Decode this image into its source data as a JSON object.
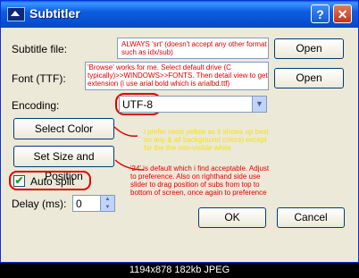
{
  "window": {
    "title": "Subtitler",
    "help_button": "?",
    "close_button": "✕"
  },
  "labels": {
    "subtitle_file": "Subtitle file:",
    "font": "Font (TTF):",
    "encoding": "Encoding:",
    "delay": "Delay (ms):"
  },
  "notes": {
    "subtitle_note": "ALWAYS 'srt' (doesn't accept any other format such as idx/sub)",
    "font_note": "'Browse' works for me.  Select default drive (C typically)>>WINDOWS>>FONTS.  Then detail view to get extension (i use arial bold which is arialbd.ttf)",
    "color_note": "i prefer neon yellow as it shows up best on any & all background colors) except for the the non-visible white",
    "size_note": "'24' is default which i find acceptable. Adjust to preference.  Also on righthand side use slider to drag position of subs from top to bottom of screen, once again to preference"
  },
  "inputs": {
    "subtitle_file_value": "",
    "font_value": "",
    "encoding_value": "UTF-8",
    "delay_value": "0"
  },
  "buttons": {
    "open_subtitle": "Open",
    "open_font": "Open",
    "select_color": "Select Color",
    "set_size_position": "Set Size and Position",
    "ok": "OK",
    "cancel": "Cancel"
  },
  "checkbox": {
    "auto_split_label": "Auto split",
    "checked": true
  },
  "footer": {
    "caption": "1194x878 182kb JPEG"
  },
  "colors": {
    "annotation_red": "#e00000",
    "annotation_yellow": "#f4e400",
    "title_bar": "#0747c9"
  }
}
